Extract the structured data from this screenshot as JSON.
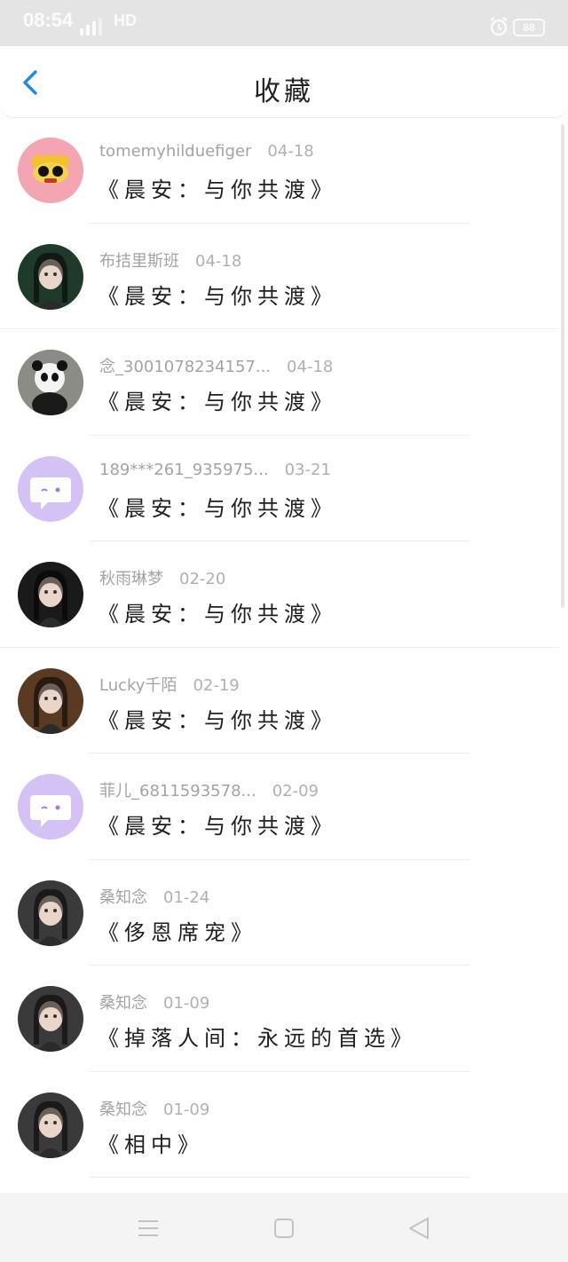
{
  "status_bar": {
    "time": "08:54",
    "network": "HD",
    "battery": "88"
  },
  "header": {
    "title": "收藏",
    "back_icon": "chevron-left-icon",
    "accent_color": "#1e88e5"
  },
  "items": [
    {
      "name": "tomemyhilduefiger",
      "date": "04-18",
      "title": "《晨安：与你共渡》",
      "avatar": "cartoon-mask-avatar",
      "avatar_color": "#f3a6b2"
    },
    {
      "name": "布拮里斯班",
      "date": "04-18",
      "title": "《晨安：与你共渡》",
      "avatar": "masked-character-avatar",
      "avatar_color": "#1f3a2b"
    },
    {
      "name": "念_3001078234157...",
      "date": "04-18",
      "title": "《晨安：与你共渡》",
      "avatar": "panda-avatar",
      "avatar_color": "#9a9a9a"
    },
    {
      "name": "189***261_935975...",
      "date": "03-21",
      "title": "《晨安：与你共渡》",
      "avatar": "default-chat-avatar",
      "avatar_color": "#d4c2f4"
    },
    {
      "name": "秋雨琳梦",
      "date": "02-20",
      "title": "《晨安：与你共渡》",
      "avatar": "girl-portrait-avatar",
      "avatar_color": "#1a1a1a"
    },
    {
      "name": "Lucky千陌",
      "date": "02-19",
      "title": "《晨安：与你共渡》",
      "avatar": "girl-portrait-avatar",
      "avatar_color": "#5a3a22"
    },
    {
      "name": "菲儿_6811593578...",
      "date": "02-09",
      "title": "《晨安：与你共渡》",
      "avatar": "default-chat-avatar",
      "avatar_color": "#d4c2f4"
    },
    {
      "name": "桑知念",
      "date": "01-24",
      "title": "《侈恩席宠》",
      "avatar": "doll-portrait-avatar",
      "avatar_color": "#3a3a3a"
    },
    {
      "name": "桑知念",
      "date": "01-09",
      "title": "《掉落人间：永远的首选》",
      "avatar": "doll-portrait-avatar",
      "avatar_color": "#3a3a3a"
    },
    {
      "name": "桑知念",
      "date": "01-09",
      "title": "《相中》",
      "avatar": "doll-portrait-avatar",
      "avatar_color": "#3a3a3a"
    }
  ],
  "nav_bar": {
    "menu_icon": "menu-icon",
    "home_icon": "square-home-icon",
    "back_icon": "triangle-back-icon"
  }
}
